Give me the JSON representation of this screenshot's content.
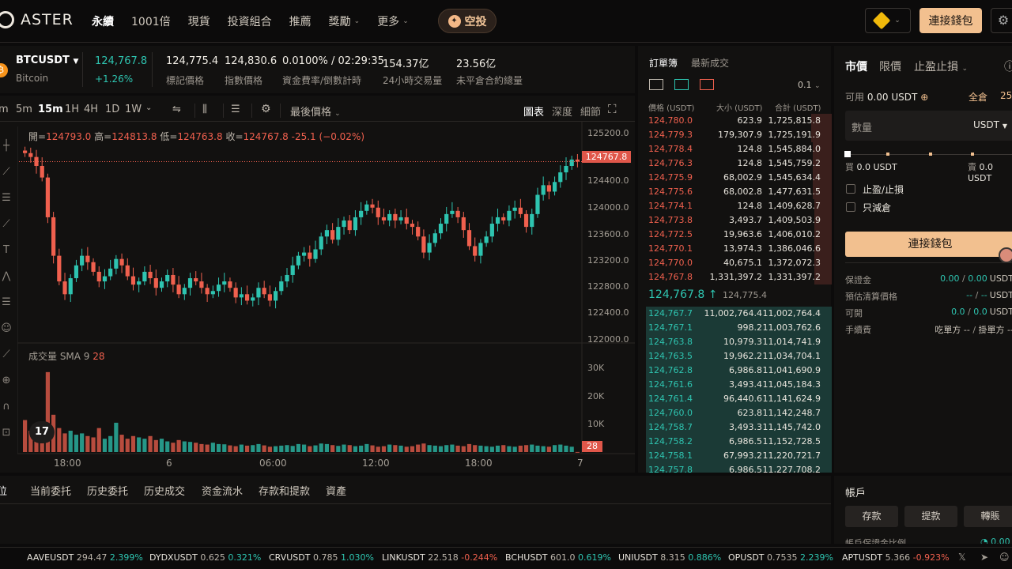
{
  "nav": {
    "brand": "ASTER",
    "items": [
      {
        "label": "永續",
        "active": true,
        "dropdown": false
      },
      {
        "label": "1001倍",
        "active": false,
        "dropdown": false
      },
      {
        "label": "現貨",
        "active": false,
        "dropdown": false
      },
      {
        "label": "投資組合",
        "active": false,
        "dropdown": false
      },
      {
        "label": "推薦",
        "active": false,
        "dropdown": false
      },
      {
        "label": "獎勵",
        "active": false,
        "dropdown": true
      },
      {
        "label": "更多",
        "active": false,
        "dropdown": true
      }
    ],
    "airdrop": "空投",
    "connect": "連接錢包"
  },
  "ticker": {
    "symbol": "BTCUSDT",
    "name": "Bitcoin",
    "last": "124,767.8",
    "change": "+1.26%",
    "mark_price": "124,775.4",
    "mark_label": "標記價格",
    "index_price": "124,830.6",
    "index_label": "指數價格",
    "funding": "0.0100% / 02:29:35",
    "funding_label": "資金費率/倒數計時",
    "volume": "154.37亿",
    "volume_label": "24小時交易量",
    "oi": "23.56亿",
    "oi_label": "未平倉合約總量"
  },
  "chart": {
    "timeframes": [
      "m",
      "5m",
      "15m",
      "1H",
      "4H",
      "1D",
      "1W"
    ],
    "active_tf": "15m",
    "price_type": "最後價格",
    "views": [
      "圖表",
      "深度",
      "細節"
    ],
    "ohlc": {
      "o_label": "開=",
      "o": "124793.0",
      "h_label": "高=",
      "h": "124813.8",
      "l_label": "低=",
      "l": "124763.8",
      "c_label": "收=",
      "c": "124767.8",
      "chg": "-25.1 (−0.02%)"
    },
    "price_tag": "124767.8",
    "volume_label": "成交量 SMA 9",
    "volume_val": "28",
    "vol_tag": "28"
  },
  "chart_data": {
    "type": "candlestick",
    "yticks": [
      "125200.0",
      "124400.0",
      "124000.0",
      "123600.0",
      "123200.0",
      "122800.0",
      "122400.0",
      "122000.0"
    ],
    "ylim": [
      121940,
      125390
    ],
    "vol_ticks": [
      "30K",
      "20K",
      "10K"
    ],
    "vol_ylim": [
      0,
      35000
    ],
    "xticks": [
      "18:00",
      "6",
      "06:00",
      "12:00",
      "18:00",
      "7"
    ],
    "close_series": [
      124900,
      124840,
      124700,
      124520,
      123900,
      123300,
      122900,
      122700,
      122950,
      123150,
      123300,
      123200,
      123050,
      122900,
      122980,
      123100,
      123250,
      123150,
      122980,
      122850,
      122900,
      123050,
      122950,
      122800,
      122900,
      123000,
      122850,
      122700,
      122800,
      122950,
      122900,
      122800,
      122700,
      122750,
      122850,
      122900,
      122800,
      122650,
      122700,
      122600,
      122650,
      122800,
      122700,
      122600,
      122750,
      122900,
      123000,
      123150,
      123300,
      123350,
      123250,
      123400,
      123600,
      123700,
      123550,
      123750,
      123850,
      123700,
      123900,
      124000,
      124100,
      124050,
      123900,
      123850,
      123950,
      123850,
      123900,
      123800,
      123750,
      123600,
      123350,
      123500,
      123650,
      123800,
      123950,
      124000,
      123900,
      123700,
      123450,
      123300,
      123500,
      123600,
      123800,
      123900,
      123850,
      124000,
      124050,
      123950,
      123750,
      123950,
      124250,
      124400,
      124300,
      124450,
      124600,
      124700,
      124800,
      124767.8
    ],
    "volume_series": [
      12000,
      8000,
      6000,
      5000,
      30000,
      14000,
      9000,
      7000,
      8000,
      6500,
      7000,
      6000,
      5500,
      9000,
      5000,
      6000,
      11000,
      6500,
      5000,
      6000,
      5500,
      5000,
      6000,
      4500,
      5000,
      4000,
      3500,
      4500,
      4000,
      3800,
      3500,
      3000,
      2800,
      3500,
      3000,
      2900,
      2500,
      2200,
      2800,
      2400,
      2600,
      3000,
      2500,
      2000,
      2200,
      2400,
      2600,
      2300,
      3000,
      2800,
      2200,
      2500,
      3200,
      3000,
      2600,
      2300,
      2800,
      2600,
      2200,
      2400,
      3000,
      2500,
      2000,
      2200,
      2800,
      2600,
      2400,
      2000,
      2200,
      2800,
      3200,
      2600,
      2400,
      2200,
      2600,
      2800,
      2400,
      2200,
      3000,
      2600,
      2400,
      2200,
      2000,
      2400,
      2600,
      2200,
      2000,
      2400,
      2600,
      2800,
      2400,
      2200,
      2000,
      2600,
      2800,
      2400,
      2000,
      28
    ]
  },
  "orderbook": {
    "tabs": [
      "訂單簿",
      "最新成交"
    ],
    "precision": "0.1",
    "headers": [
      "價格 (USDT)",
      "大小 (USDT)",
      "合計 (USDT)"
    ],
    "asks": [
      {
        "p": "124,780.0",
        "s": "623.9",
        "t": "1,725,815.8",
        "d": 0.95
      },
      {
        "p": "124,779.3",
        "s": "179,307.9",
        "t": "1,725,191.9",
        "d": 0.95
      },
      {
        "p": "124,778.4",
        "s": "124.8",
        "t": "1,545,884.0",
        "d": 0.85
      },
      {
        "p": "124,776.3",
        "s": "124.8",
        "t": "1,545,759.2",
        "d": 0.85
      },
      {
        "p": "124,775.9",
        "s": "68,002.9",
        "t": "1,545,634.4",
        "d": 0.85
      },
      {
        "p": "124,775.6",
        "s": "68,002.8",
        "t": "1,477,631.5",
        "d": 0.81
      },
      {
        "p": "124,774.1",
        "s": "124.8",
        "t": "1,409,628.7",
        "d": 0.77
      },
      {
        "p": "124,773.8",
        "s": "3,493.7",
        "t": "1,409,503.9",
        "d": 0.77
      },
      {
        "p": "124,772.5",
        "s": "19,963.6",
        "t": "1,406,010.2",
        "d": 0.77
      },
      {
        "p": "124,770.1",
        "s": "13,974.3",
        "t": "1,386,046.6",
        "d": 0.76
      },
      {
        "p": "124,770.0",
        "s": "40,675.1",
        "t": "1,372,072.3",
        "d": 0.75
      },
      {
        "p": "124,767.8",
        "s": "1,331,397.2",
        "t": "1,331,397.2",
        "d": 0.73
      }
    ],
    "mid": "124,767.8 ↑",
    "mid_mark": "124,775.4",
    "bids": [
      {
        "p": "124,767.7",
        "s": "11,002,764.4",
        "t": "11,002,764.4"
      },
      {
        "p": "124,767.1",
        "s": "998.2",
        "t": "11,003,762.6"
      },
      {
        "p": "124,763.8",
        "s": "10,979.3",
        "t": "11,014,741.9"
      },
      {
        "p": "124,763.5",
        "s": "19,962.2",
        "t": "11,034,704.1"
      },
      {
        "p": "124,762.8",
        "s": "6,986.8",
        "t": "11,041,690.9"
      },
      {
        "p": "124,761.6",
        "s": "3,493.4",
        "t": "11,045,184.3"
      },
      {
        "p": "124,761.4",
        "s": "96,440.6",
        "t": "11,141,624.9"
      },
      {
        "p": "124,760.0",
        "s": "623.8",
        "t": "11,142,248.7"
      },
      {
        "p": "124,758.7",
        "s": "3,493.3",
        "t": "11,145,742.0"
      },
      {
        "p": "124,758.2",
        "s": "6,986.5",
        "t": "11,152,728.5"
      },
      {
        "p": "124,758.1",
        "s": "67,993.2",
        "t": "11,220,721.7"
      },
      {
        "p": "124,757.8",
        "s": "6,986.5",
        "t": "11,227,708.2"
      }
    ]
  },
  "form": {
    "tabs": [
      "市價",
      "限價",
      "止盈止損"
    ],
    "avail_label": "可用",
    "avail": "0.00 USDT",
    "margin_mode": "全倉",
    "leverage": "25",
    "qty_placeholder": "數量",
    "unit": "USDT",
    "buy_label": "買",
    "buy_val": "0.0 USDT",
    "sell_label": "賣",
    "sell_val": "0.0 USDT",
    "tpsl": "止盈/止損",
    "reduce_only": "只減倉",
    "connect": "連接錢包",
    "rows": [
      {
        "label": "保證金",
        "val1": "0.00",
        "val2": "0.00",
        "unit": "USDT"
      },
      {
        "label": "預估清算價格",
        "val1": "--",
        "val2": "--",
        "unit": "USDT"
      },
      {
        "label": "可開",
        "val1": "0.0",
        "val2": "0.0",
        "unit": "USDT"
      },
      {
        "label": "手續費",
        "val1": "吃單方 --",
        "val2": "掛單方 --",
        "unit": ""
      }
    ]
  },
  "bottom": {
    "tabs": [
      "位",
      "当前委托",
      "历史委托",
      "历史成交",
      "资金流水",
      "存款和提款",
      "資產"
    ]
  },
  "account": {
    "title": "帳戶",
    "buttons": [
      "存款",
      "提款",
      "轉賬"
    ],
    "ratio_label": "帳戶保證金比例",
    "ratio_val": "0.00"
  },
  "marquee": [
    {
      "sym": "AAVEUSDT",
      "px": "294.47",
      "chg": "2.399%",
      "up": true
    },
    {
      "sym": "DYDXUSDT",
      "px": "0.625",
      "chg": "0.321%",
      "up": true
    },
    {
      "sym": "CRVUSDT",
      "px": "0.785",
      "chg": "1.030%",
      "up": true
    },
    {
      "sym": "LINKUSDT",
      "px": "22.518",
      "chg": "-0.244%",
      "up": false
    },
    {
      "sym": "BCHUSDT",
      "px": "601.0",
      "chg": "0.619%",
      "up": true
    },
    {
      "sym": "UNIUSDT",
      "px": "8.315",
      "chg": "0.886%",
      "up": true
    },
    {
      "sym": "OPUSDT",
      "px": "0.7535",
      "chg": "2.239%",
      "up": true
    },
    {
      "sym": "APTUSDT",
      "px": "5.366",
      "chg": "-0.923%",
      "up": false
    }
  ],
  "colors": {
    "up": "#2ec4b0",
    "down": "#f0604e",
    "accent": "#f2c08f"
  }
}
